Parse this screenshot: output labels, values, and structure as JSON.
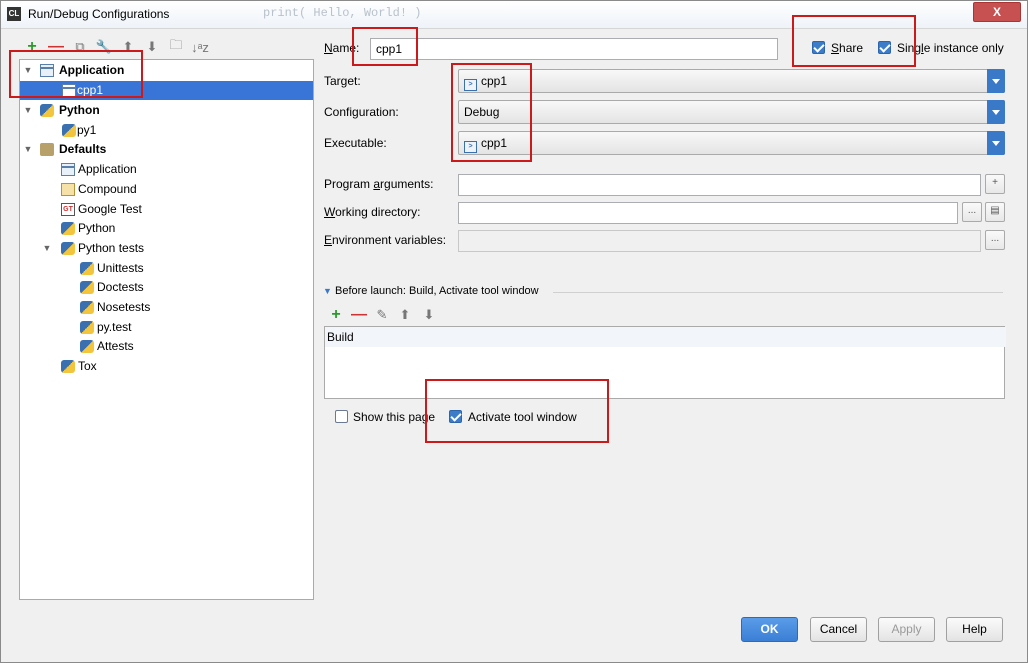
{
  "window": {
    "title": "Run/Debug Configurations",
    "icon_text": "CL",
    "ghost_code": "print( Hello, World! )",
    "close": "X"
  },
  "toolbar": {
    "icons": [
      "add-icon",
      "remove-icon",
      "copy-icon",
      "wrench-icon",
      "move-up-icon",
      "move-down-icon",
      "folder-icon",
      "sort-icon"
    ],
    "add": "+",
    "remove": "—",
    "copy": "⧉",
    "wrench": "🔧",
    "up": "⬆",
    "down": "⬇",
    "folder": "🗀",
    "sort": "↓ᵃz"
  },
  "tree": {
    "items": [
      {
        "label": "Application",
        "level": 0,
        "bold": true,
        "expanded": true
      },
      {
        "label": "cpp1",
        "level": 1,
        "selected": true
      },
      {
        "label": "Python",
        "level": 0,
        "bold": true,
        "expanded": true
      },
      {
        "label": "py1",
        "level": 1
      },
      {
        "label": "Defaults",
        "level": 0,
        "bold": true,
        "expanded": true
      },
      {
        "label": "Application",
        "level": 1
      },
      {
        "label": "Compound",
        "level": 1
      },
      {
        "label": "Google Test",
        "level": 1
      },
      {
        "label": "Python",
        "level": 1
      },
      {
        "label": "Python tests",
        "level": 1,
        "expanded": true
      },
      {
        "label": "Unittests",
        "level": 2
      },
      {
        "label": "Doctests",
        "level": 2
      },
      {
        "label": "Nosetests",
        "level": 2
      },
      {
        "label": "py.test",
        "level": 2
      },
      {
        "label": "Attests",
        "level": 2
      },
      {
        "label": "Tox",
        "level": 1
      }
    ]
  },
  "form": {
    "name_label_n": "N",
    "name_label_rest": "ame:",
    "name_value": "cpp1",
    "share_label_s": "S",
    "share_label_rest": "hare",
    "share_checked": true,
    "single_label_pre": "Sing",
    "single_label_l": "l",
    "single_label_rest": "e instance only",
    "single_checked": true,
    "target_label": "Target:",
    "target_value": "cpp1",
    "configuration_label": "Configuration:",
    "configuration_value": "Debug",
    "executable_label": "Executable:",
    "executable_value": "cpp1",
    "program_args_label_pre": "Program ",
    "program_args_label_a": "a",
    "program_args_label_rest": "rguments:",
    "program_args_value": "",
    "working_dir_label_w": "W",
    "working_dir_label_rest": "orking directory:",
    "working_dir_value": "",
    "env_vars_label_e": "E",
    "env_vars_label_rest": "nvironment variables:",
    "env_vars_value": "",
    "browse": "...",
    "insert_macro": "+"
  },
  "before_launch": {
    "title": "Before launch: Build, Activate tool window",
    "tools": [
      "add-icon",
      "remove-icon",
      "edit-icon",
      "move-up-icon",
      "move-down-icon"
    ],
    "add": "+",
    "remove": "—",
    "edit": "✎",
    "up": "⬆",
    "down": "⬇",
    "items": [
      "Build"
    ],
    "show_page_label": "Show this page",
    "show_page_checked": false,
    "activate_label": "Activate tool window",
    "activate_checked": true
  },
  "buttons": {
    "ok": "OK",
    "cancel": "Cancel",
    "apply": "Apply",
    "help": "Help"
  },
  "colors": {
    "selection": "#3875d7",
    "annotation": "#cc1a1a",
    "primary_button": "#3b7fd6",
    "dropdown": "#3a78c8"
  }
}
